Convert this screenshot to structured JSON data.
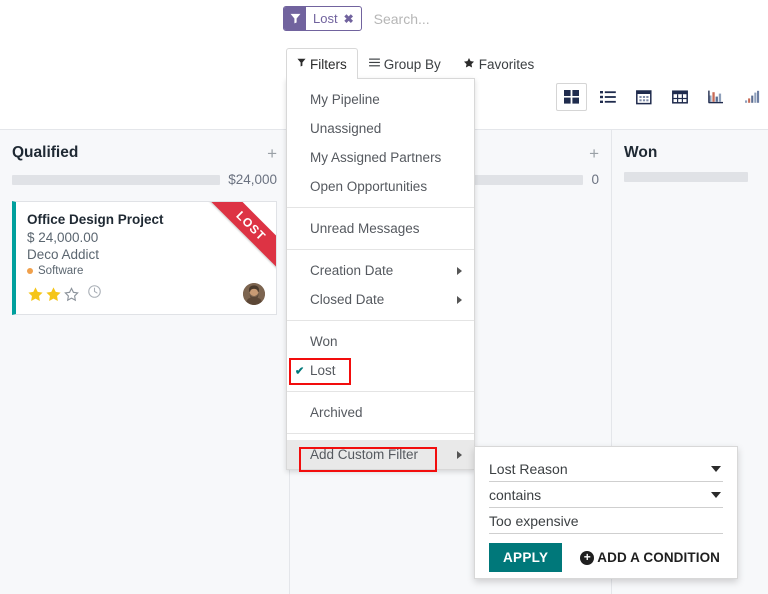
{
  "search": {
    "facet_label": "Lost",
    "facet_icon": "filter-icon",
    "facet_remove": "✖",
    "placeholder": "Search..."
  },
  "dropdown_tabs": [
    {
      "label": "Filters",
      "icon": "▼",
      "active": true
    },
    {
      "label": "Group By",
      "icon": "≡",
      "active": false
    },
    {
      "label": "Favorites",
      "icon": "★",
      "active": false
    }
  ],
  "filters_menu": {
    "groups": [
      {
        "items": [
          {
            "label": "My Pipeline"
          },
          {
            "label": "Unassigned"
          },
          {
            "label": "My Assigned Partners"
          },
          {
            "label": "Open Opportunities"
          }
        ]
      },
      {
        "items": [
          {
            "label": "Unread Messages"
          }
        ]
      },
      {
        "items": [
          {
            "label": "Creation Date",
            "submenu": true
          },
          {
            "label": "Closed Date",
            "submenu": true
          }
        ]
      },
      {
        "items": [
          {
            "label": "Won"
          },
          {
            "label": "Lost",
            "checked": true,
            "highlight": true
          }
        ]
      },
      {
        "items": [
          {
            "label": "Archived"
          }
        ]
      },
      {
        "items": [
          {
            "label": "Add Custom Filter",
            "submenu": true,
            "hovered": true,
            "highlight": true
          }
        ]
      }
    ],
    "check_glyph": "✔"
  },
  "custom_filter": {
    "field": "Lost Reason",
    "operator": "contains",
    "value": "Too expensive",
    "apply_label": "APPLY",
    "add_condition_label": "ADD A CONDITION",
    "plus_glyph": "+"
  },
  "view_switcher": {
    "views": [
      {
        "name": "kanban-view",
        "active": true
      },
      {
        "name": "list-view",
        "active": false
      },
      {
        "name": "calendar-view",
        "active": false
      },
      {
        "name": "pivot-view",
        "active": false
      },
      {
        "name": "graph-view",
        "active": false
      },
      {
        "name": "cohort-view",
        "active": false
      }
    ]
  },
  "kanban": {
    "columns": [
      {
        "title": "Qualified",
        "plus": "+",
        "amount": "$24,000",
        "cards": [
          {
            "title": "Office Design Project",
            "amount": "$ 24,000.00",
            "customer": "Deco Addict",
            "tag": "Software",
            "stars_filled": 2,
            "stars_total": 3,
            "ribbon": "LOST"
          }
        ]
      },
      {
        "title": "",
        "plus": "+",
        "amount": "0",
        "cards": []
      },
      {
        "title": "Won",
        "plus": "",
        "amount": "",
        "cards": []
      }
    ]
  },
  "colors": {
    "facet_purple": "#71639e",
    "accent_teal": "#00787a",
    "card_accent": "#00a09d",
    "ribbon_red": "#dd3344",
    "highlight_red": "#f20d0d",
    "star_gold": "#f5c518",
    "tag_orange": "#f0a04b"
  }
}
